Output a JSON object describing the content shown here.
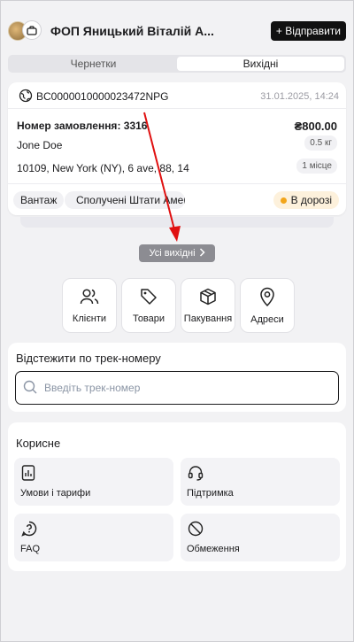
{
  "header": {
    "company": "ФОП Яницький Віталій А...",
    "send_label": "+ Відправити"
  },
  "tabs": [
    {
      "label": "Чернетки",
      "active": false
    },
    {
      "label": "Вихідні",
      "active": true
    }
  ],
  "shipment": {
    "tracking_number": "BC0000010000023472NPG",
    "datetime": "31.01.2025, 14:24",
    "order_number": "Номер замовлення: 3316",
    "amount": "₴800.00",
    "recipient": "Jone Doe",
    "weight": "0.5 кг",
    "address": "10109, New York (NY), 6 ave, 88, 14",
    "places": "1 місце",
    "cargo_type": "Вантаж",
    "country": "Сполучені Штати Америки",
    "status": "В дорозі"
  },
  "all_outgoing_label": "Усі вихідні",
  "quick_actions": [
    {
      "label": "Клієнти",
      "icon": "users-icon"
    },
    {
      "label": "Товари",
      "icon": "tag-icon"
    },
    {
      "label": "Пакування",
      "icon": "box-icon"
    },
    {
      "label": "Адреси",
      "icon": "map-pin-icon"
    }
  ],
  "track": {
    "title": "Відстежити по трек-номеру",
    "placeholder": "Введіть трек-номер"
  },
  "useful": {
    "title": "Корисне",
    "items": [
      {
        "label": "Умови і тарифи",
        "icon": "document-chart-icon"
      },
      {
        "label": "Підтримка",
        "icon": "headset-icon"
      },
      {
        "label": "FAQ",
        "icon": "question-icon"
      },
      {
        "label": "Обмеження",
        "icon": "prohibited-icon"
      }
    ]
  },
  "colors": {
    "annotation_arrow": "#e01010",
    "status_dot": "#f2a51a"
  }
}
